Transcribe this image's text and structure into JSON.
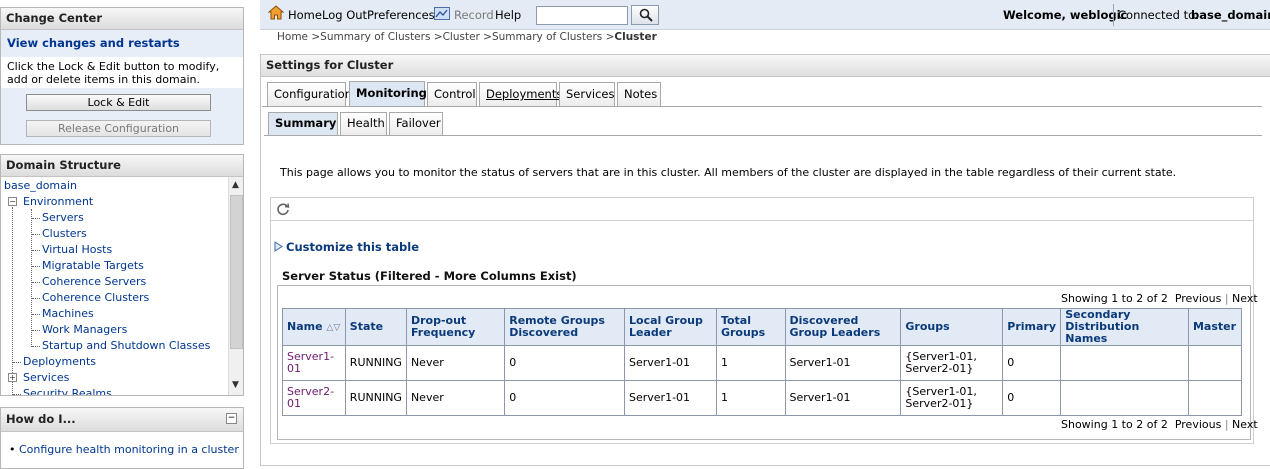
{
  "change_center": {
    "title": "Change Center",
    "view_changes": "View changes and restarts",
    "instructions": "Click the Lock & Edit button to modify, add or delete items in this domain.",
    "lock_edit": "Lock & Edit",
    "release": "Release Configuration"
  },
  "domain_structure": {
    "title": "Domain Structure",
    "root": "base_domain",
    "environment": "Environment",
    "children": [
      "Servers",
      "Clusters",
      "Virtual Hosts",
      "Migratable Targets",
      "Coherence Servers",
      "Coherence Clusters",
      "Machines",
      "Work Managers",
      "Startup and Shutdown Classes"
    ],
    "deployments": "Deployments",
    "services": "Services",
    "security_realms": "Security Realms"
  },
  "how_do_i": {
    "title": "How do I...",
    "items": [
      "Configure health monitoring in a cluster"
    ]
  },
  "topbar": {
    "home": "Home",
    "logout": "Log Out",
    "preferences": "Preferences",
    "record": "Record",
    "help": "Help",
    "search_value": "",
    "welcome": "Welcome, weblogic",
    "connected_label": "Connected to:",
    "connected_domain": "base_domain"
  },
  "breadcrumb": {
    "parts": [
      "Home >",
      "Summary of Clusters >",
      "Cluster >",
      "Summary of Clusters >"
    ],
    "current": "Cluster"
  },
  "settings": {
    "title": "Settings for Cluster",
    "tabs": [
      "Configuration",
      "Monitoring",
      "Control",
      "Deployments",
      "Services",
      "Notes"
    ],
    "active_tab": "Monitoring",
    "subtabs": [
      "Summary",
      "Health",
      "Failover"
    ],
    "active_subtab": "Summary",
    "description": "This page allows you to monitor the status of servers that are in this cluster. All members of the cluster are displayed in the table regardless of their current state.",
    "customize": "Customize this table",
    "table_title": "Server Status (Filtered - More Columns Exist)"
  },
  "pager": {
    "showing": "Showing 1 to 2 of 2",
    "previous": "Previous",
    "separator": "|",
    "next": "Next"
  },
  "table": {
    "headers": [
      "Name",
      "State",
      "Drop-out Frequency",
      "Remote Groups Discovered",
      "Local Group Leader",
      "Total Groups",
      "Discovered Group Leaders",
      "Groups",
      "Primary",
      "Secondary Distribution Names",
      "Master"
    ],
    "rows": [
      [
        "Server1-01",
        "RUNNING",
        "Never",
        "0",
        "Server1-01",
        "1",
        "Server1-01",
        "{Server1-01, Server2-01}",
        "0",
        "",
        ""
      ],
      [
        "Server2-01",
        "RUNNING",
        "Never",
        "0",
        "Server1-01",
        "1",
        "Server1-01",
        "{Server1-01, Server2-01}",
        "0",
        "",
        ""
      ]
    ]
  },
  "colors": {
    "link": "#00368f",
    "header_bg": "#e2eaf5",
    "topbar_bg": "#e4ebf5",
    "server_link": "#6d1b6d"
  }
}
